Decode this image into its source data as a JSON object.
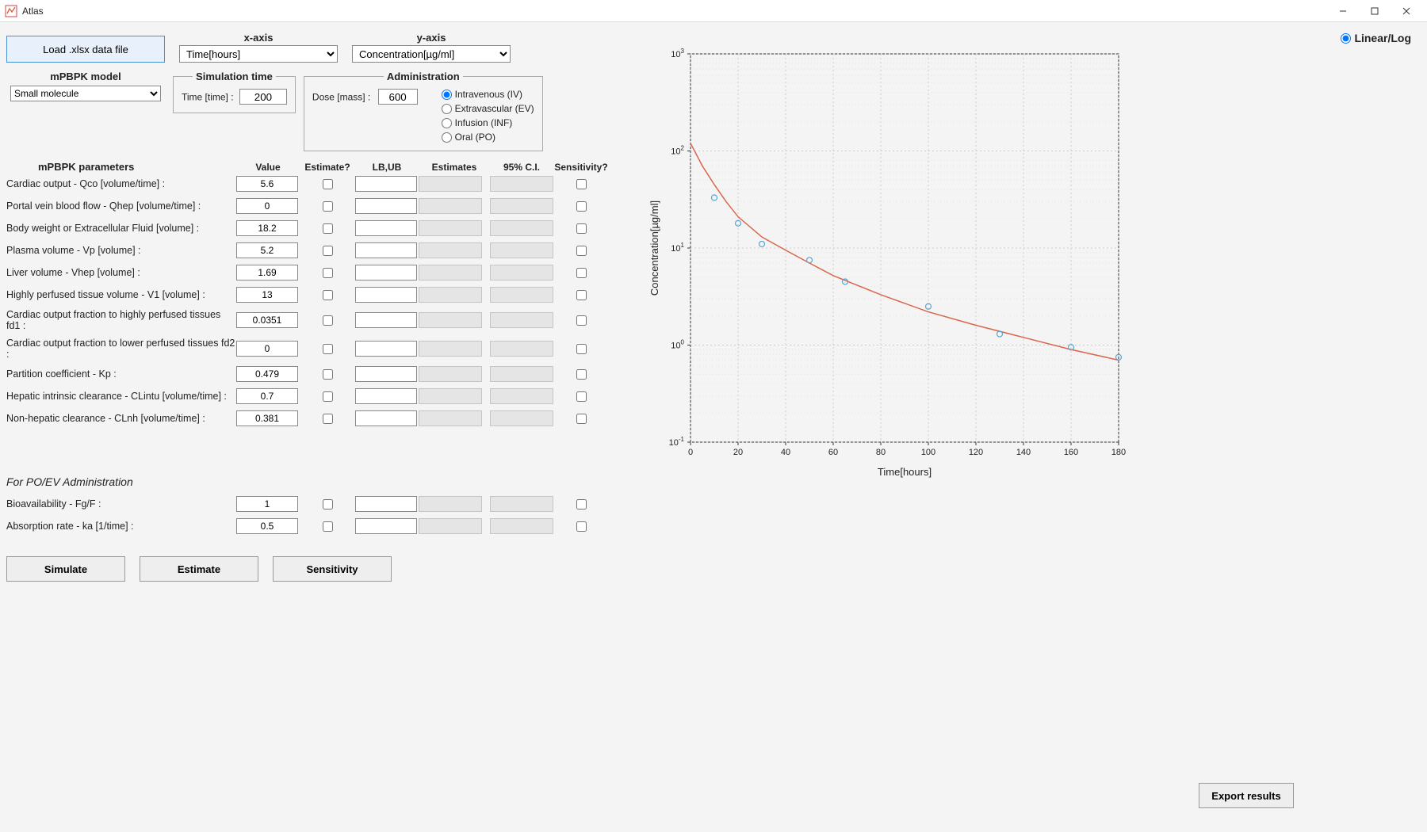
{
  "window": {
    "title": "Atlas"
  },
  "top": {
    "load_button": "Load .xlsx data file",
    "xaxis_label": "x-axis",
    "xaxis_value": "Time[hours]",
    "yaxis_label": "y-axis",
    "yaxis_value": "Concentration[µg/ml]"
  },
  "model": {
    "label": "mPBPK model",
    "value": "Small molecule"
  },
  "simtime": {
    "legend": "Simulation time",
    "label": "Time [time] :",
    "value": "200"
  },
  "admin": {
    "legend": "Administration",
    "dose_label": "Dose [mass] :",
    "dose_value": "600",
    "options": {
      "iv": "Intravenous (IV)",
      "ev": "Extravascular (EV)",
      "inf": "Infusion (INF)",
      "po": "Oral (PO)"
    },
    "selected": "iv"
  },
  "params": {
    "header": "mPBPK parameters",
    "cols": {
      "value": "Value",
      "estimate": "Estimate?",
      "lbub": "LB,UB",
      "estimates": "Estimates",
      "ci": "95% C.I.",
      "sens": "Sensitivity?"
    },
    "rows": [
      {
        "label": "Cardiac output - Qco [volume/time] :",
        "value": "5.6"
      },
      {
        "label": "Portal vein blood flow - Qhep [volume/time] :",
        "value": "0"
      },
      {
        "label": "Body weight or Extracellular Fluid [volume] :",
        "value": "18.2"
      },
      {
        "label": "Plasma volume - Vp [volume] :",
        "value": "5.2"
      },
      {
        "label": "Liver volume - Vhep [volume] :",
        "value": "1.69"
      },
      {
        "label": "Highly perfused tissue volume - V1 [volume] :",
        "value": "13"
      },
      {
        "label": "Cardiac output fraction to highly perfused tissues fd1 :",
        "value": "0.0351"
      },
      {
        "label": "Cardiac output fraction to lower perfused tissues fd2 :",
        "value": "0"
      },
      {
        "label": "Partition coefficient - Kp :",
        "value": "0.479"
      },
      {
        "label": "Hepatic intrinsic clearance - CLintu [volume/time] :",
        "value": "0.7"
      },
      {
        "label": "Non-hepatic clearance - CLnh [volume/time] :",
        "value": "0.381"
      }
    ]
  },
  "poev": {
    "header": "For PO/EV Administration",
    "rows": [
      {
        "label": "Bioavailability - Fg/F :",
        "value": "1"
      },
      {
        "label": "Absorption rate - ka [1/time] :",
        "value": "0.5"
      }
    ]
  },
  "buttons": {
    "simulate": "Simulate",
    "estimate": "Estimate",
    "sensitivity": "Sensitivity",
    "export": "Export results"
  },
  "linlog_label": "Linear/Log",
  "chart_data": {
    "type": "line",
    "title": "",
    "xlabel": "Time[hours]",
    "ylabel": "Concentration[µg/ml]",
    "xlim": [
      0,
      180
    ],
    "ylim_log": [
      -1,
      3
    ],
    "xticks": [
      0,
      20,
      40,
      60,
      80,
      100,
      120,
      140,
      160,
      180
    ],
    "yticks_exp": [
      -1,
      0,
      1,
      2,
      3
    ],
    "series": [
      {
        "name": "fit",
        "kind": "line",
        "color": "#d9664a",
        "x": [
          0,
          5,
          10,
          15,
          20,
          30,
          40,
          50,
          60,
          80,
          100,
          120,
          140,
          160,
          180
        ],
        "y": [
          120,
          70,
          45,
          30,
          21,
          13,
          9.5,
          7,
          5.2,
          3.3,
          2.2,
          1.6,
          1.2,
          0.9,
          0.7
        ]
      },
      {
        "name": "data",
        "kind": "scatter",
        "color": "#5aa4d4",
        "x": [
          10,
          20,
          30,
          50,
          65,
          100,
          130,
          160,
          180
        ],
        "y": [
          33,
          18,
          11,
          7.5,
          4.5,
          2.5,
          1.3,
          0.95,
          0.75
        ]
      }
    ]
  }
}
